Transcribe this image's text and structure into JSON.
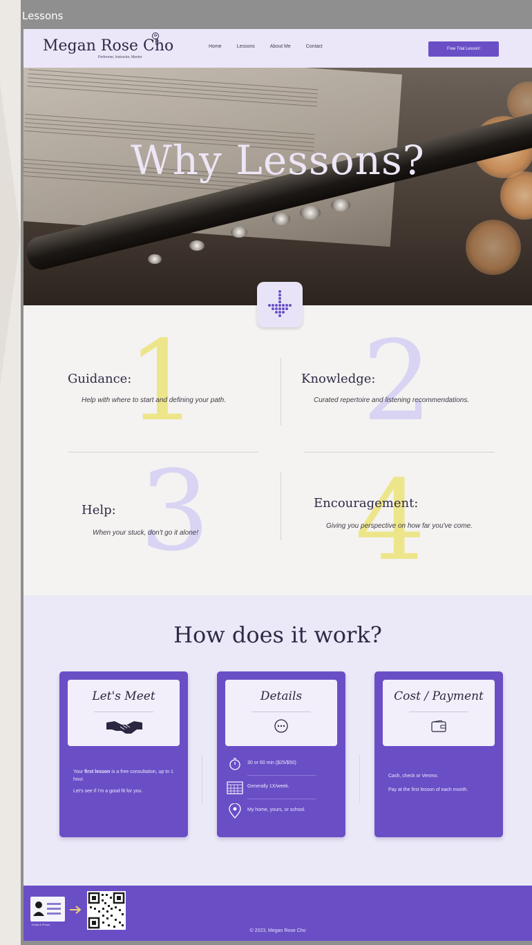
{
  "window": {
    "title": "Lessons"
  },
  "header": {
    "name": "Megan Rose Cho",
    "tagline": "Performer, Instructor, Mentor",
    "nav": [
      "Home",
      "Lessons",
      "About Me",
      "Contact"
    ],
    "cta_label": "Free Trial Lesson!"
  },
  "hero": {
    "title": "Why Lessons?"
  },
  "reasons": [
    {
      "number": "1",
      "title": "Guidance:",
      "description": "Help with where to start and defining your path."
    },
    {
      "number": "2",
      "title": "Knowledge:",
      "description": "Curated repertoire and listening recommendations."
    },
    {
      "number": "3",
      "title": "Help:",
      "description": "When your stuck, don't go it alone!"
    },
    {
      "number": "4",
      "title": "Encouragement:",
      "description": "Giving you perspective on how far you've come."
    }
  ],
  "how": {
    "title": "How does it work?",
    "cards": [
      {
        "title": "Let's Meet",
        "icon": "handshake-icon",
        "paragraph1_pre": "Your ",
        "paragraph1_bold": "first lesson",
        "paragraph1_post": " is a free consultation, up to 1 hour.",
        "paragraph2": "Let's see if I'm a good fit for you."
      },
      {
        "title": "Details",
        "icon": "ellipsis-circle-icon",
        "items": [
          {
            "icon": "stopwatch-icon",
            "text": "30 or 60 min ($25/$50)"
          },
          {
            "icon": "calendar-icon",
            "text": "Generally 1X/week."
          },
          {
            "icon": "location-pin-icon",
            "text": "My home, yours, or school."
          }
        ]
      },
      {
        "title": "Cost / Payment",
        "icon": "wallet-icon",
        "paragraph1": "Cash, check or Venmo.",
        "paragraph2": "Pay at the first lesson of each month."
      }
    ]
  },
  "footer": {
    "contact_label": "Email & Phone",
    "copyright": "© 2023, Megan Rose Cho"
  },
  "colors": {
    "accent": "#6a4ec6",
    "header_bg": "#ebe7f8",
    "yellow_numeral": "#ede58a",
    "lavender_numeral": "#d9d4f3"
  }
}
